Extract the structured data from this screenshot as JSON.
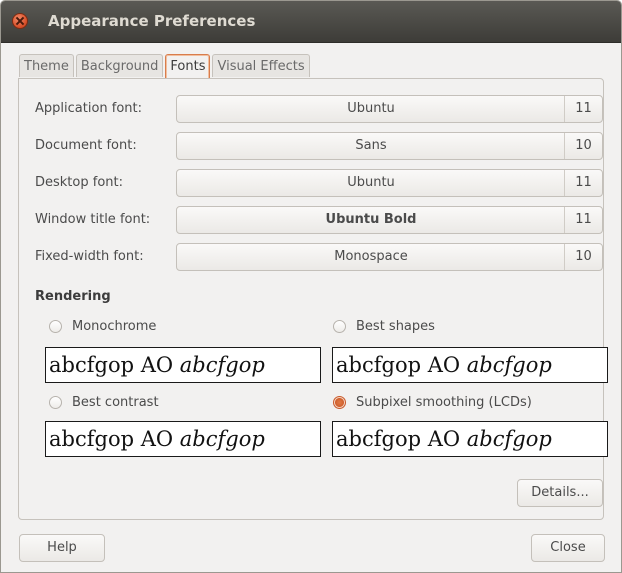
{
  "window": {
    "title": "Appearance Preferences"
  },
  "tabs": [
    {
      "label": "Theme"
    },
    {
      "label": "Background"
    },
    {
      "label": "Fonts"
    },
    {
      "label": "Visual Effects"
    }
  ],
  "fonts": [
    {
      "label": "Application font:",
      "font": "Ubuntu",
      "size": "11"
    },
    {
      "label": "Document font:",
      "font": "Sans",
      "size": "10"
    },
    {
      "label": "Desktop font:",
      "font": "Ubuntu",
      "size": "11"
    },
    {
      "label": "Window title font:",
      "font": "Ubuntu Bold",
      "size": "11"
    },
    {
      "label": "Fixed-width font:",
      "font": "Monospace",
      "size": "10"
    }
  ],
  "rendering": {
    "heading": "Rendering",
    "options": [
      {
        "label": "Monochrome",
        "selected": false
      },
      {
        "label": "Best shapes",
        "selected": false
      },
      {
        "label": "Best contrast",
        "selected": false
      },
      {
        "label": "Subpixel smoothing (LCDs)",
        "selected": true
      }
    ],
    "sample_regular": "abcfgop AO ",
    "sample_italic": "abcfgop"
  },
  "buttons": {
    "details": "Details...",
    "help": "Help",
    "close": "Close"
  },
  "colors": {
    "accent": "#d8622f",
    "titlebar": "#3d3c38"
  }
}
